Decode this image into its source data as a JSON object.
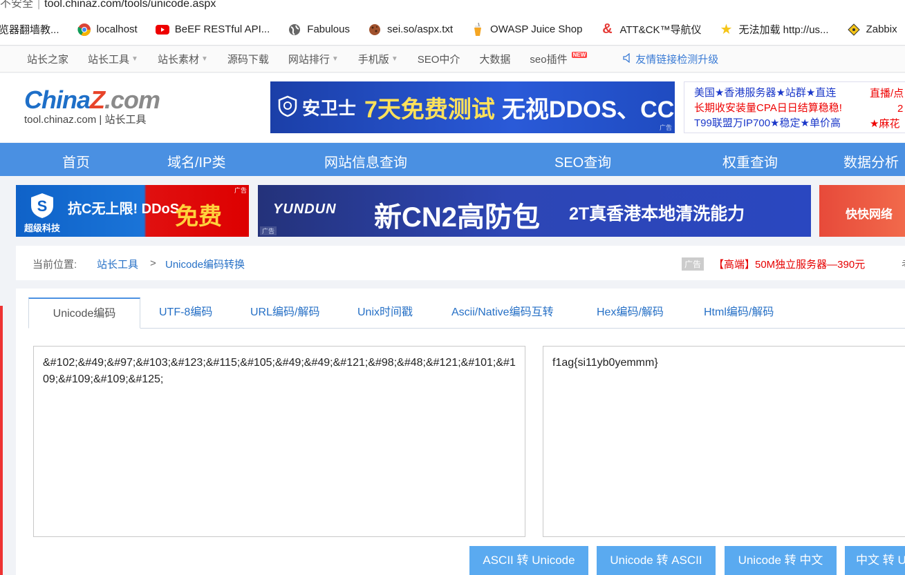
{
  "address_bar": {
    "security": "不安全",
    "separator": "|",
    "url": "tool.chinaz.com/tools/unicode.aspx"
  },
  "bookmarks": [
    {
      "label": "览器翻墙教...",
      "icon": "none"
    },
    {
      "label": "localhost",
      "icon": "chrome-icon"
    },
    {
      "label": "BeEF RESTful API...",
      "icon": "youtube-icon"
    },
    {
      "label": "Fabulous",
      "icon": "globe-icon"
    },
    {
      "label": "sei.so/aspx.txt",
      "icon": "cookie-icon"
    },
    {
      "label": "OWASP Juice Shop",
      "icon": "juice-icon"
    },
    {
      "label": "ATT&CK™导航仪",
      "icon": "ampersand-icon"
    },
    {
      "label": "无法加载 http://us...",
      "icon": "star-icon"
    },
    {
      "label": "Zabbix",
      "icon": "diamond-icon"
    }
  ],
  "top_nav": {
    "items": [
      "站长之家",
      "站长工具",
      "站长素材",
      "源码下载",
      "网站排行",
      "手机版",
      "SEO中介",
      "大数据",
      "seo插件"
    ],
    "new_badge": "NEW",
    "upgrade_link": "友情链接检测升级"
  },
  "logo": {
    "china": "China",
    "z": "Z",
    "com": ".com",
    "subtitle": "tool.chinaz.com | 站长工具"
  },
  "header_ad": {
    "brand": "安卫士",
    "slogan": "7天免费测试",
    "slogan2": "无视DDOS、CC",
    "tag": "广告"
  },
  "text_ads": {
    "line1": "美国★香港服务器★站群★直连",
    "line2": "长期收安装量CPA日日结算稳稳!",
    "line3": "T99联盟万IP700★稳定★单价高",
    "col2_line1": "直播/点",
    "col2_line2": "2",
    "col2_line3": "★麻花"
  },
  "main_nav": [
    "首页",
    "域名/IP类",
    "网站信息查询",
    "SEO查询",
    "权重查询",
    "数据分析"
  ],
  "banners": {
    "left": {
      "title": "抗C无上限! DDoS",
      "company": "超级科技",
      "free": "免费",
      "tag": "广告"
    },
    "middle": {
      "brand": "YUNDUN",
      "main": "新CN2高防包",
      "sub": "2T真香港本地清洗能力",
      "tag": "广告"
    },
    "right": {
      "brand": "快快网络"
    }
  },
  "breadcrumb": {
    "label": "当前位置:",
    "crumb1": "站长工具",
    "separator": ">",
    "crumb2": "Unicode编码转换",
    "ad_tag": "广告",
    "ad_link": "【高端】50M独立服务器—390元",
    "more": "考"
  },
  "tabs": [
    "Unicode编码",
    "UTF-8编码",
    "URL编码/解码",
    "Unix时间戳",
    "Ascii/Native编码互转",
    "Hex编码/解码",
    "Html编码/解码"
  ],
  "tool": {
    "input_text": "&#102;&#49;&#97;&#103;&#123;&#115;&#105;&#49;&#49;&#121;&#98;&#48;&#121;&#101;&#109;&#109;&#109;&#125;",
    "output_text": "f1ag{si11yb0yemmm}"
  },
  "buttons": [
    "ASCII 转 Unicode",
    "Unicode 转 ASCII",
    "Unicode 转 中文",
    "中文 转 Unicode"
  ],
  "colors": {
    "nav_blue": "#4a90e2",
    "link_blue": "#2670c6",
    "button_blue": "#5aaaf0",
    "ad_red": "#e60000"
  }
}
